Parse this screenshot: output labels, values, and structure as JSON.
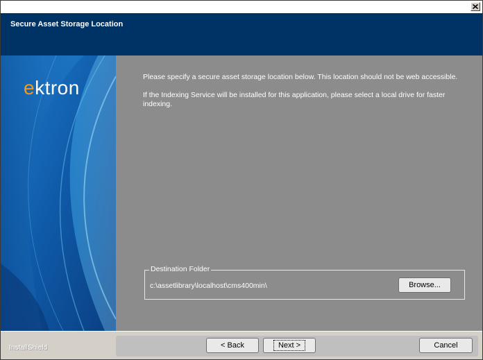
{
  "header": {
    "title": "Secure Asset Storage Location"
  },
  "side": {
    "logo_text": "ektron"
  },
  "content": {
    "description_line1": "Please specify a secure asset storage location below. This location should not be web accessible.",
    "description_line2": "If the Indexing Service will be installed for this application, please select a local drive for faster indexing.",
    "destination_folder_label": "Destination Folder",
    "destination_path": "c:\\assetlibrary\\localhost\\cms400min\\",
    "browse_label": "Browse..."
  },
  "footer": {
    "brand": "InstallShield",
    "back_label": "< Back",
    "next_label": "Next >",
    "cancel_label": "Cancel"
  },
  "colors": {
    "header_bg": "#003365",
    "content_bg": "#8c8c8c",
    "logo_orange": "#f39a1e"
  },
  "icons": {
    "close": "close-icon"
  }
}
